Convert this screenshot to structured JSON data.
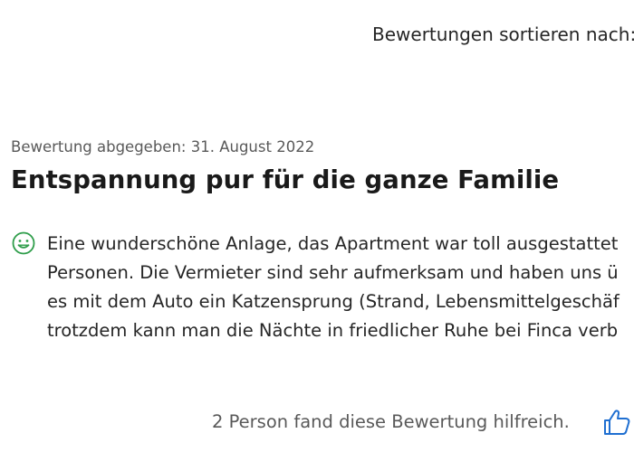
{
  "sort": {
    "label": "Bewertungen sortieren nach:"
  },
  "review": {
    "date": "Bewertung abgegeben: 31. August 2022",
    "title": "Entspannung pur für die ganze Familie",
    "sentiment_icon": "smile-icon",
    "body_lines": [
      "Eine wunderschöne Anlage, das Apartment war toll ausgestattet",
      "Personen. Die Vermieter sind sehr aufmerksam und haben uns ü",
      "es mit dem Auto ein Katzensprung (Strand, Lebensmittelgeschäf",
      "trotzdem kann man die Nächte in friedlicher Ruhe bei Finca verb"
    ],
    "helpful_text": "2 Person fand diese Bewertung hilfreich.",
    "helpful_icon": "thumbs-up-icon"
  },
  "colors": {
    "positive_icon": "#2e9d4a",
    "action_icon": "#1f6fd1"
  }
}
